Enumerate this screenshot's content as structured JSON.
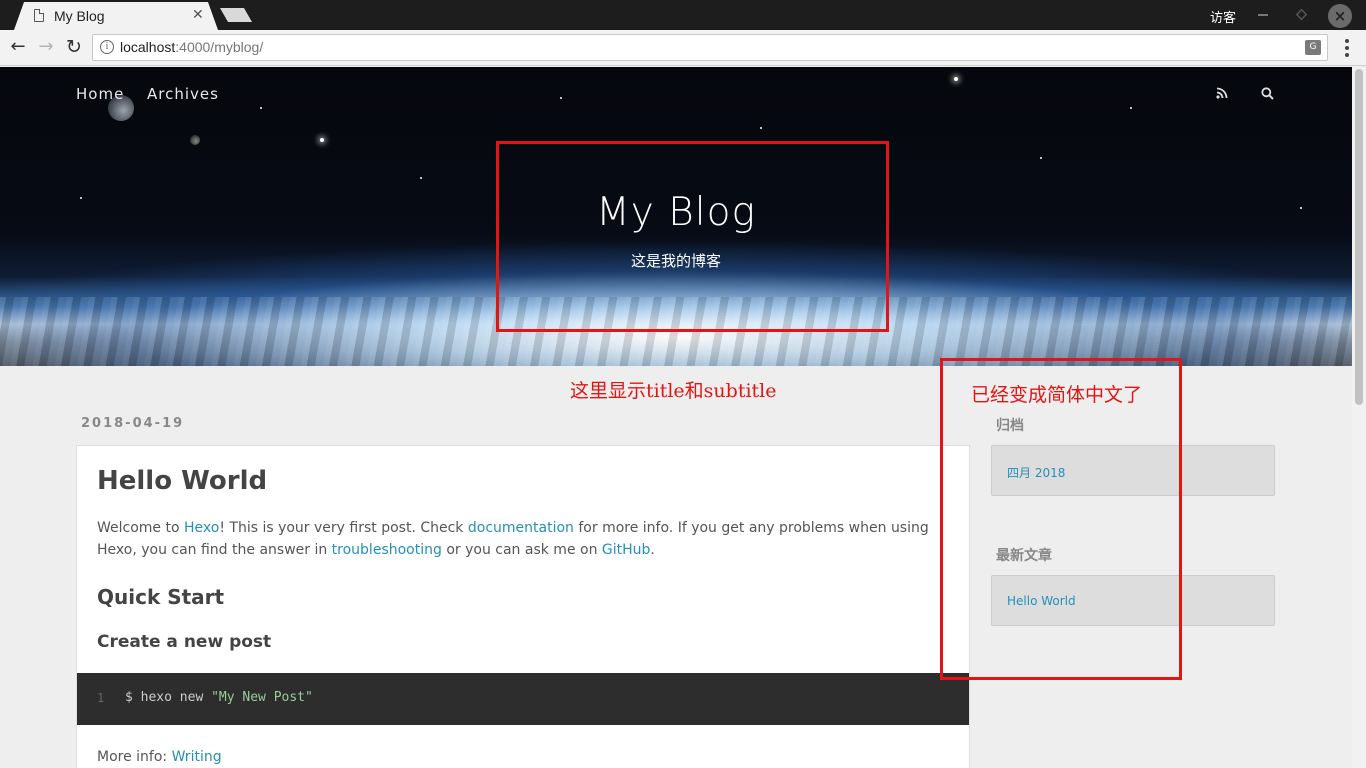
{
  "browser": {
    "tab_title": "My Blog",
    "tab_close": "✕",
    "user_label": "访客",
    "url_host": "localhost",
    "url_rest": ":4000/myblog/",
    "info_glyph": "i",
    "translate_glyph": "G"
  },
  "nav": {
    "home": "Home",
    "archives": "Archives"
  },
  "hero": {
    "title": "My Blog",
    "subtitle": "这是我的博客"
  },
  "annotations": {
    "title_note": "这里显示title和subtitle",
    "sidebar_note": "已经变成简体中文了",
    "color": "#e41414"
  },
  "post": {
    "date": "2018-04-19",
    "title": "Hello World",
    "intro": {
      "t1": "Welcome to ",
      "link1": "Hexo",
      "t2": "! This is your very first post. Check ",
      "link2": "documentation",
      "t3": " for more info. If you get any problems when using Hexo, you can find the answer in ",
      "link3": "troubleshooting",
      "t4": " or you can ask me on ",
      "link4": "GitHub",
      "t5": "."
    },
    "heading_quick_start": "Quick Start",
    "heading_create_post": "Create a new post",
    "code": {
      "line_no": "1",
      "command": "$ hexo new ",
      "string": "\"My New Post\""
    },
    "more_info_label": "More info: ",
    "more_info_link": "Writing"
  },
  "sidebar": {
    "archive_heading": "归档",
    "archive_item": "四月 2018",
    "recent_heading": "最新文章",
    "recent_item": "Hello World"
  },
  "colors": {
    "link": "#258fb8",
    "code_bg": "#2d2d2d",
    "page_bg": "#eeeeee"
  }
}
